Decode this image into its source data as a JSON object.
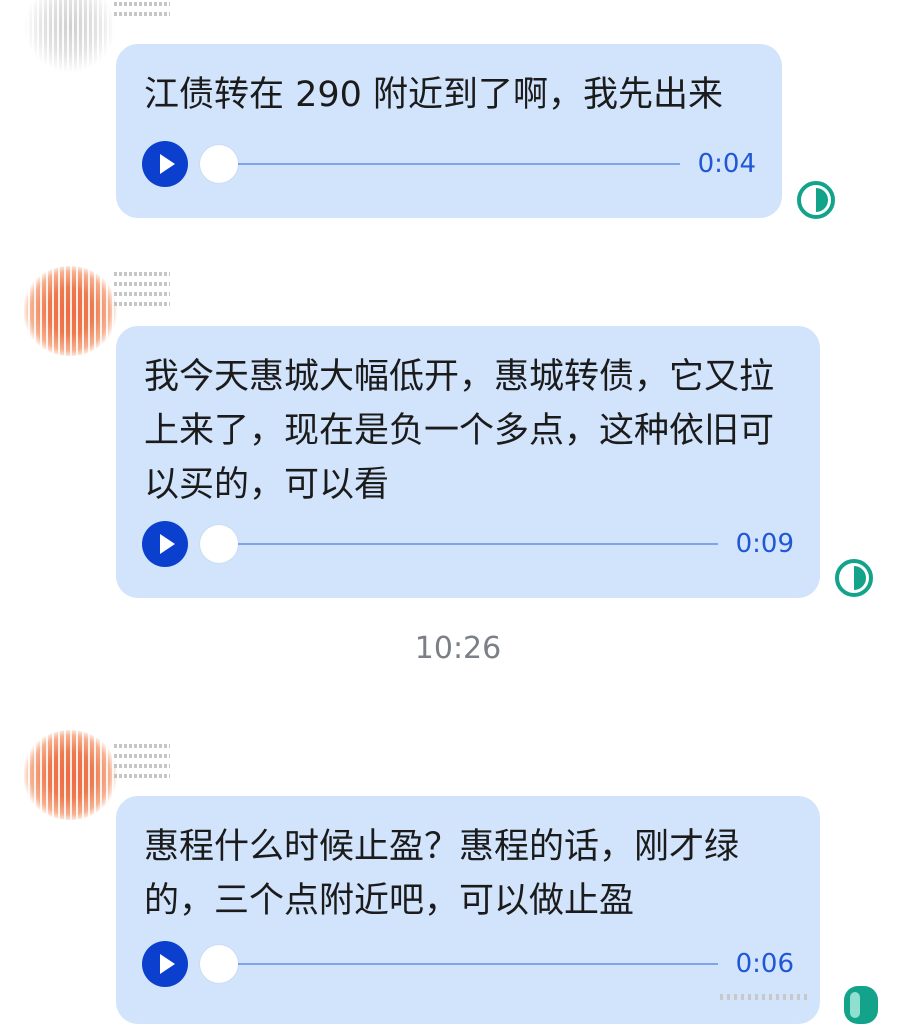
{
  "messages": [
    {
      "text": "江债转在 290 附近到了啊，我先出来",
      "audio_duration": "0:04",
      "playback_progress": 0,
      "status_icon": "sent-status-icon"
    },
    {
      "text": "我今天惠城大幅低开，惠城转债，它又拉上来了，现在是负一个多点，这种依旧可以买的，可以看",
      "audio_duration": "0:09",
      "playback_progress": 0,
      "status_icon": "sent-status-icon"
    },
    {
      "text": "惠程什么时候止盈？惠程的话，刚才绿的，三个点附近吧，可以做止盈",
      "audio_duration": "0:06",
      "playback_progress": 0,
      "status_icon": "sent-status-icon"
    }
  ],
  "timestamp": "10:26",
  "colors": {
    "bubble": "#d2e3fc",
    "play_button": "#0b3fce",
    "duration_text": "#1f57d6",
    "status_icon": "#12a38a",
    "timestamp_text": "#7b7f86"
  },
  "icons": {
    "play": "play-icon",
    "status": "sent-status-icon"
  }
}
